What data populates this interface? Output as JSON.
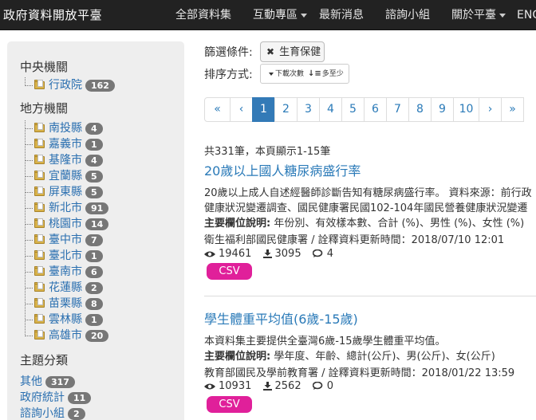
{
  "nav": {
    "brand": "政府資料開放平臺",
    "items": [
      {
        "label": "全部資料集",
        "dropdown": false
      },
      {
        "label": "互動專區",
        "dropdown": true
      },
      {
        "label": "最新消息",
        "dropdown": false
      },
      {
        "label": "諮詢小組",
        "dropdown": false
      },
      {
        "label": "關於平臺",
        "dropdown": true
      },
      {
        "label": "ENG",
        "dropdown": false
      }
    ]
  },
  "sidebar": {
    "central": {
      "title": "中央機關",
      "items": [
        {
          "label": "行政院",
          "count": "162"
        }
      ]
    },
    "local": {
      "title": "地方機關",
      "items": [
        {
          "label": "南投縣",
          "count": "4"
        },
        {
          "label": "嘉義市",
          "count": "1"
        },
        {
          "label": "基隆市",
          "count": "4"
        },
        {
          "label": "宜蘭縣",
          "count": "5"
        },
        {
          "label": "屏東縣",
          "count": "5"
        },
        {
          "label": "新北市",
          "count": "91"
        },
        {
          "label": "桃園市",
          "count": "14"
        },
        {
          "label": "臺中市",
          "count": "7"
        },
        {
          "label": "臺北市",
          "count": "1"
        },
        {
          "label": "臺南市",
          "count": "6"
        },
        {
          "label": "花蓮縣",
          "count": "2"
        },
        {
          "label": "苗栗縣",
          "count": "8"
        },
        {
          "label": "雲林縣",
          "count": "1"
        },
        {
          "label": "高雄市",
          "count": "20"
        }
      ]
    },
    "topics": {
      "title": "主題分類",
      "items": [
        {
          "label": "其他",
          "count": "317"
        },
        {
          "label": "政府統計",
          "count": "11"
        },
        {
          "label": "諮詢小組",
          "count": "2"
        }
      ]
    }
  },
  "filters": {
    "filter_label": "篩選條件:",
    "active_tag": "生育保健",
    "sort_label": "排序方式:",
    "sort_option_1": "下載次數",
    "sort_option_2": "多至少"
  },
  "pagination": {
    "first": "«",
    "prev": "‹",
    "pages": [
      "1",
      "2",
      "3",
      "4",
      "5",
      "6",
      "7",
      "8",
      "9",
      "10"
    ],
    "active": "1",
    "next": "›",
    "last": "»"
  },
  "results": {
    "summary": "共331筆，本頁顯示1-15筆",
    "items": [
      {
        "title": "20歲以上國人糖尿病盛行率",
        "desc1": "20歲以上成人自述經醫師診斷告知有糖尿病盛行率。 資料來源：前行政",
        "desc2": "健康狀況變遷調查、國民健康署民國102-104年國民營養健康狀況變遷",
        "fields_label": "主要欄位說明:",
        "fields": " 年份別、有效樣本數、合計 (%)、男性 (%)、女性 (%)",
        "source": "衛生福利部國民健康署 / 詮釋資料更新時間：2018/07/10 12:01",
        "views": "19461",
        "downloads": "3095",
        "comments": "4",
        "format": "CSV"
      },
      {
        "title": "學生體重平均值(6歲-15歲)",
        "desc1": "本資料集主要提供全臺灣6歲-15歲學生體重平均值。",
        "desc2": "",
        "fields_label": "主要欄位說明:",
        "fields": " 學年度、年齡、總計(公斤)、男(公斤)、女(公斤)",
        "source": "教育部國民及學前教育署 / 詮釋資料更新時間：2018/01/22 13:59",
        "views": "10931",
        "downloads": "2562",
        "comments": "0",
        "format": "CSV"
      }
    ]
  }
}
